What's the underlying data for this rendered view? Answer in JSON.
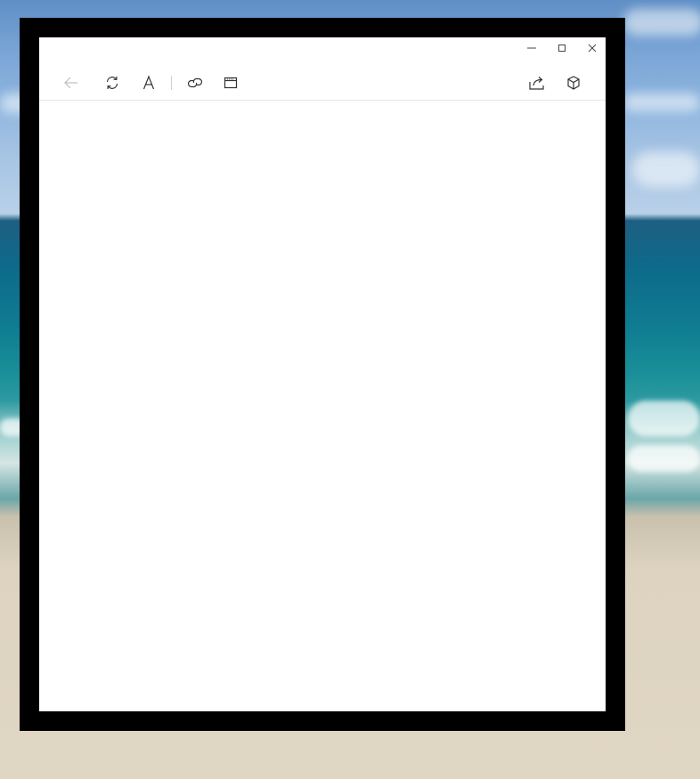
{
  "desktop": {
    "wallpaper": "beach-ocean"
  },
  "window": {
    "caption_buttons": [
      {
        "name": "minimize-button",
        "icon": "minimize-icon"
      },
      {
        "name": "maximize-button",
        "icon": "maximize-icon"
      },
      {
        "name": "close-button",
        "icon": "close-icon"
      }
    ]
  },
  "toolbar": {
    "left_buttons": [
      {
        "name": "back-button",
        "icon": "arrow-left-icon",
        "enabled": false
      },
      {
        "name": "refresh-button",
        "icon": "refresh-icon",
        "enabled": true
      },
      {
        "name": "text-size-button",
        "icon": "font-a-icon",
        "enabled": true
      },
      {
        "name": "link-button",
        "icon": "link-icon",
        "enabled": true
      },
      {
        "name": "window-button",
        "icon": "browser-window-icon",
        "enabled": true
      }
    ],
    "right_buttons": [
      {
        "name": "share-button",
        "icon": "share-icon",
        "enabled": true
      },
      {
        "name": "3d-view-button",
        "icon": "cube-icon",
        "enabled": true
      }
    ],
    "icon_color": "#333333",
    "disabled_icon_color": "#bdbdbd"
  },
  "content": {
    "background": "#ffffff"
  }
}
